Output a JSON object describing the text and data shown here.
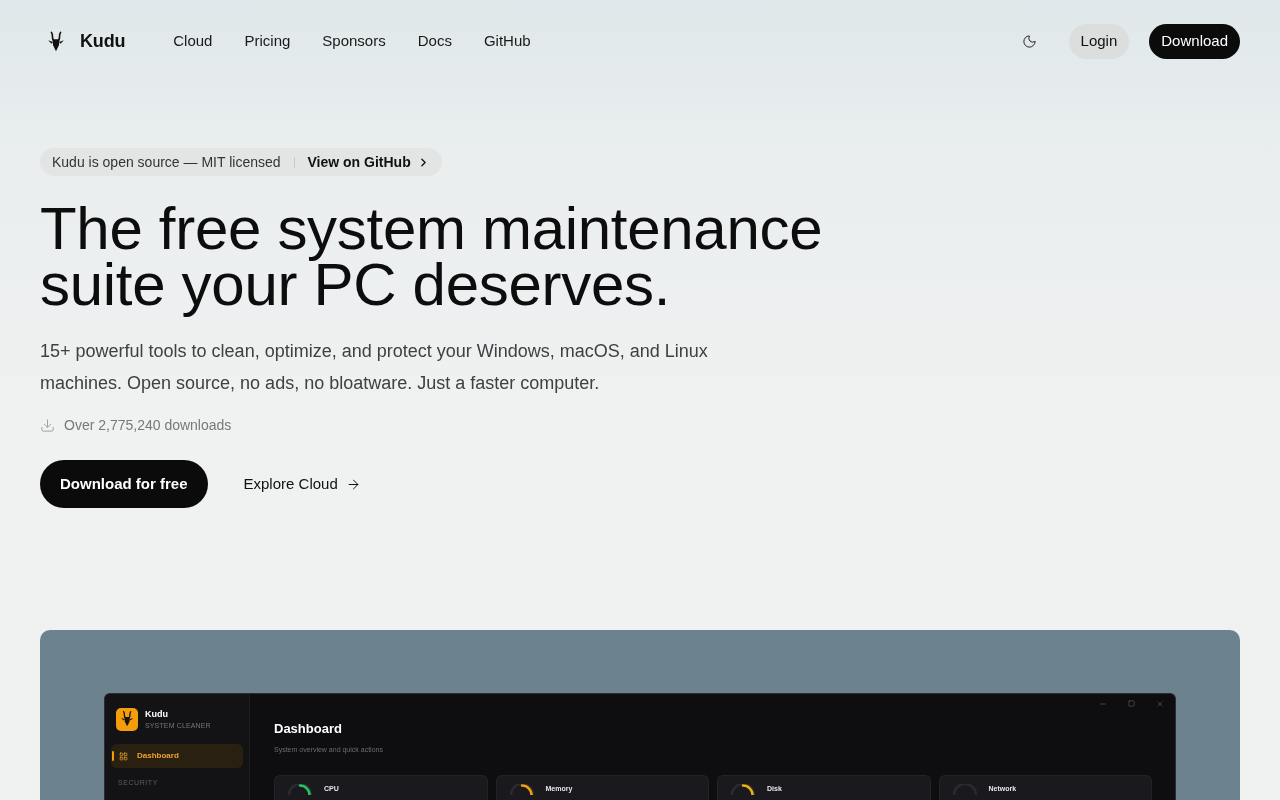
{
  "nav": {
    "brand": "Kudu",
    "links": [
      {
        "label": "Cloud"
      },
      {
        "label": "Pricing"
      },
      {
        "label": "Sponsors"
      },
      {
        "label": "Docs"
      },
      {
        "label": "GitHub"
      }
    ],
    "login": "Login",
    "download": "Download"
  },
  "announcement": {
    "text": "Kudu is open source — MIT licensed",
    "link": "View on GitHub"
  },
  "hero": {
    "title": "The free system maintenance suite your PC deserves.",
    "description": "15+ powerful tools to clean, optimize, and protect your Windows, macOS, and Linux machines. Open source, no ads, no bloatware. Just a faster computer.",
    "downloads": "Over 2,775,240 downloads",
    "primary_button": "Download for free",
    "secondary_link": "Explore Cloud"
  },
  "app_preview": {
    "sidebar": {
      "brand": "Kudu",
      "subtitle": "SYSTEM CLEANER",
      "items": [
        {
          "label": "Dashboard",
          "selected": true
        }
      ],
      "section": "SECURITY"
    },
    "title": "Dashboard",
    "subtitle": "System overview and quick actions",
    "cards": [
      {
        "label": "CPU",
        "color": "#22c55e"
      },
      {
        "label": "Memory",
        "color": "#f59e0b"
      },
      {
        "label": "Disk",
        "color": "#eab308"
      },
      {
        "label": "Network"
      }
    ]
  }
}
